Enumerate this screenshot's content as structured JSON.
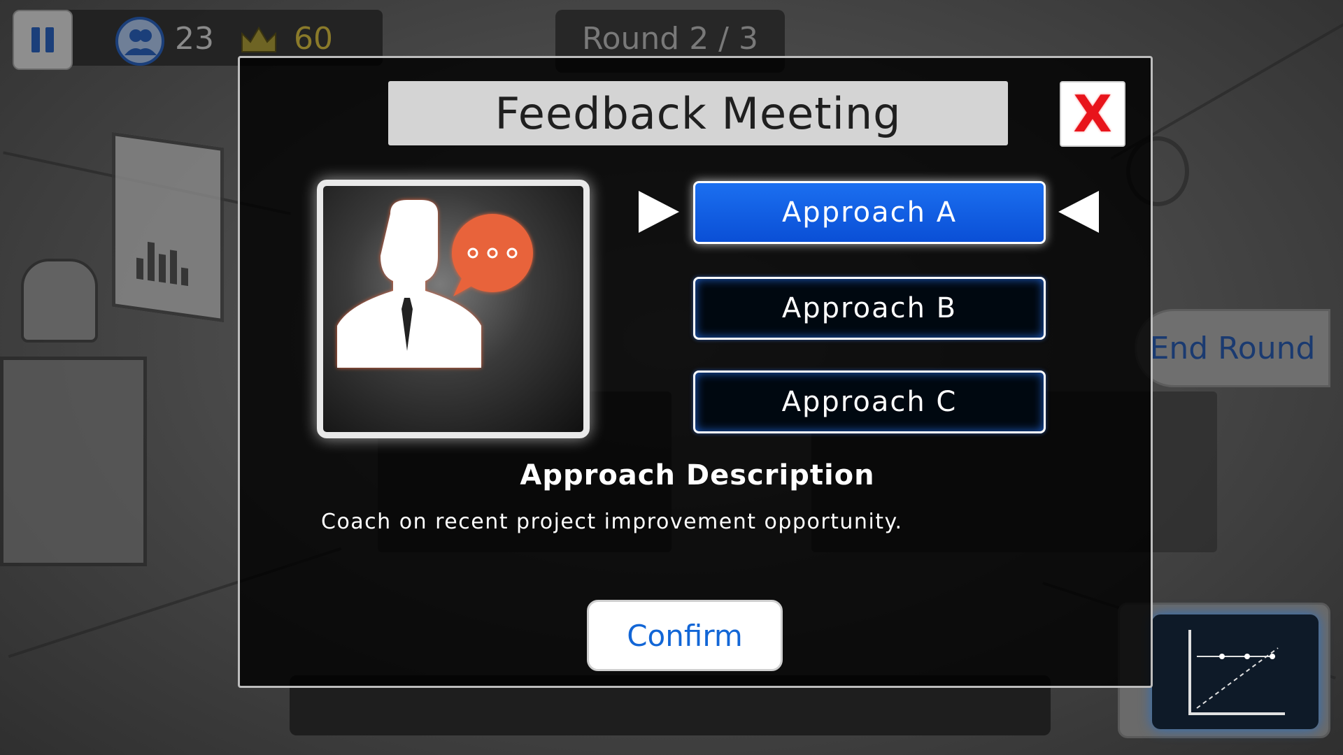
{
  "hud": {
    "team_count": "23",
    "crown_score": "60",
    "round_label": "Round 2 / 3",
    "end_round_label": "End Round"
  },
  "modal": {
    "title": "Feedback Meeting",
    "close_label": "X",
    "approaches": [
      {
        "label": "Approach A",
        "selected": true
      },
      {
        "label": "Approach B",
        "selected": false
      },
      {
        "label": "Approach C",
        "selected": false
      }
    ],
    "description_title": "Approach Description",
    "description_text": "Coach on recent project improvement opportunity.",
    "confirm_label": "Confirm"
  },
  "icons": {
    "pause": "pause-icon",
    "team": "people-icon",
    "crown": "crown-icon",
    "portrait": "person-speech-icon",
    "chart": "line-chart-icon"
  },
  "colors": {
    "selected_button": "#0a4fd6",
    "close_x": "#e8141b",
    "speech_bubble": "#e8643a",
    "confirm_text": "#1266d6",
    "crown": "#b8a23a"
  }
}
